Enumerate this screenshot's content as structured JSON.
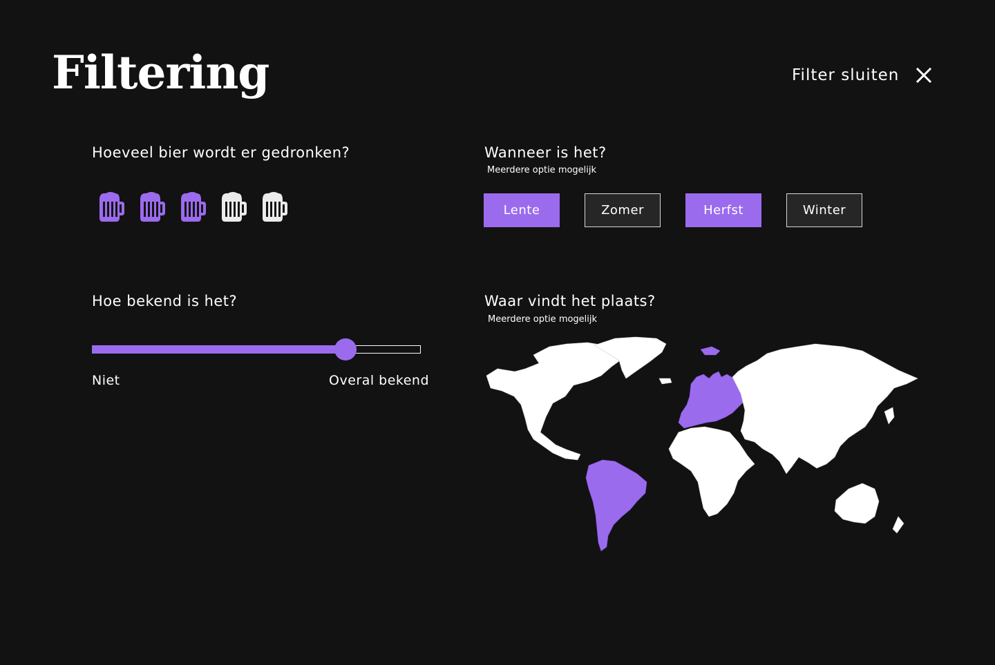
{
  "page": {
    "title": "Filtering",
    "close_label": "Filter sluiten"
  },
  "colors": {
    "background": "#121212",
    "accent": "#9b6bee",
    "text": "#ffffff",
    "unselected_button": "#262626",
    "map_land": "#ffffff"
  },
  "beer": {
    "question": "Hoeveel bier wordt er gedronken?",
    "icon": "beer-mug-icon",
    "selected": 3,
    "total": 5
  },
  "season": {
    "question": "Wanneer is het?",
    "hint": "Meerdere optie mogelijk",
    "options": [
      {
        "label": "Lente",
        "selected": true
      },
      {
        "label": "Zomer",
        "selected": false
      },
      {
        "label": "Herfst",
        "selected": true
      },
      {
        "label": "Winter",
        "selected": false
      }
    ]
  },
  "fame": {
    "question": "Hoe bekend is het?",
    "min_label": "Niet",
    "max_label": "Overal bekend",
    "value": 0.77
  },
  "location": {
    "question": "Waar vindt het plaats?",
    "hint": "Meerdere optie mogelijk",
    "regions": [
      {
        "id": "europe",
        "selected": true
      },
      {
        "id": "south-america",
        "selected": true
      },
      {
        "id": "north-america",
        "selected": false
      },
      {
        "id": "africa",
        "selected": false
      },
      {
        "id": "asia",
        "selected": false
      },
      {
        "id": "oceania",
        "selected": false
      }
    ]
  }
}
